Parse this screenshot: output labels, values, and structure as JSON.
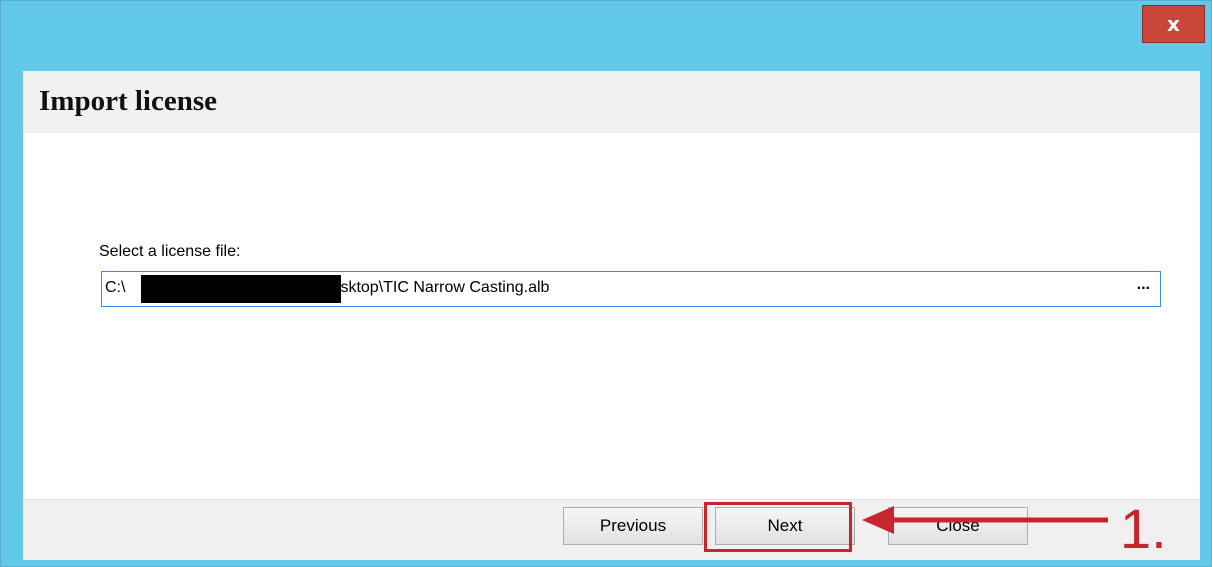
{
  "window": {
    "close_glyph": "x",
    "title": "Import license"
  },
  "form": {
    "label": "Select a license file:",
    "path_prefix": "C:\\",
    "path_suffix": "Desktop\\TIC Narrow Casting.alb",
    "browse_label": "..."
  },
  "buttons": {
    "previous": "Previous",
    "next": "Next",
    "close": "Close"
  },
  "annotation": {
    "step": "1.",
    "color": "#c8262e"
  }
}
